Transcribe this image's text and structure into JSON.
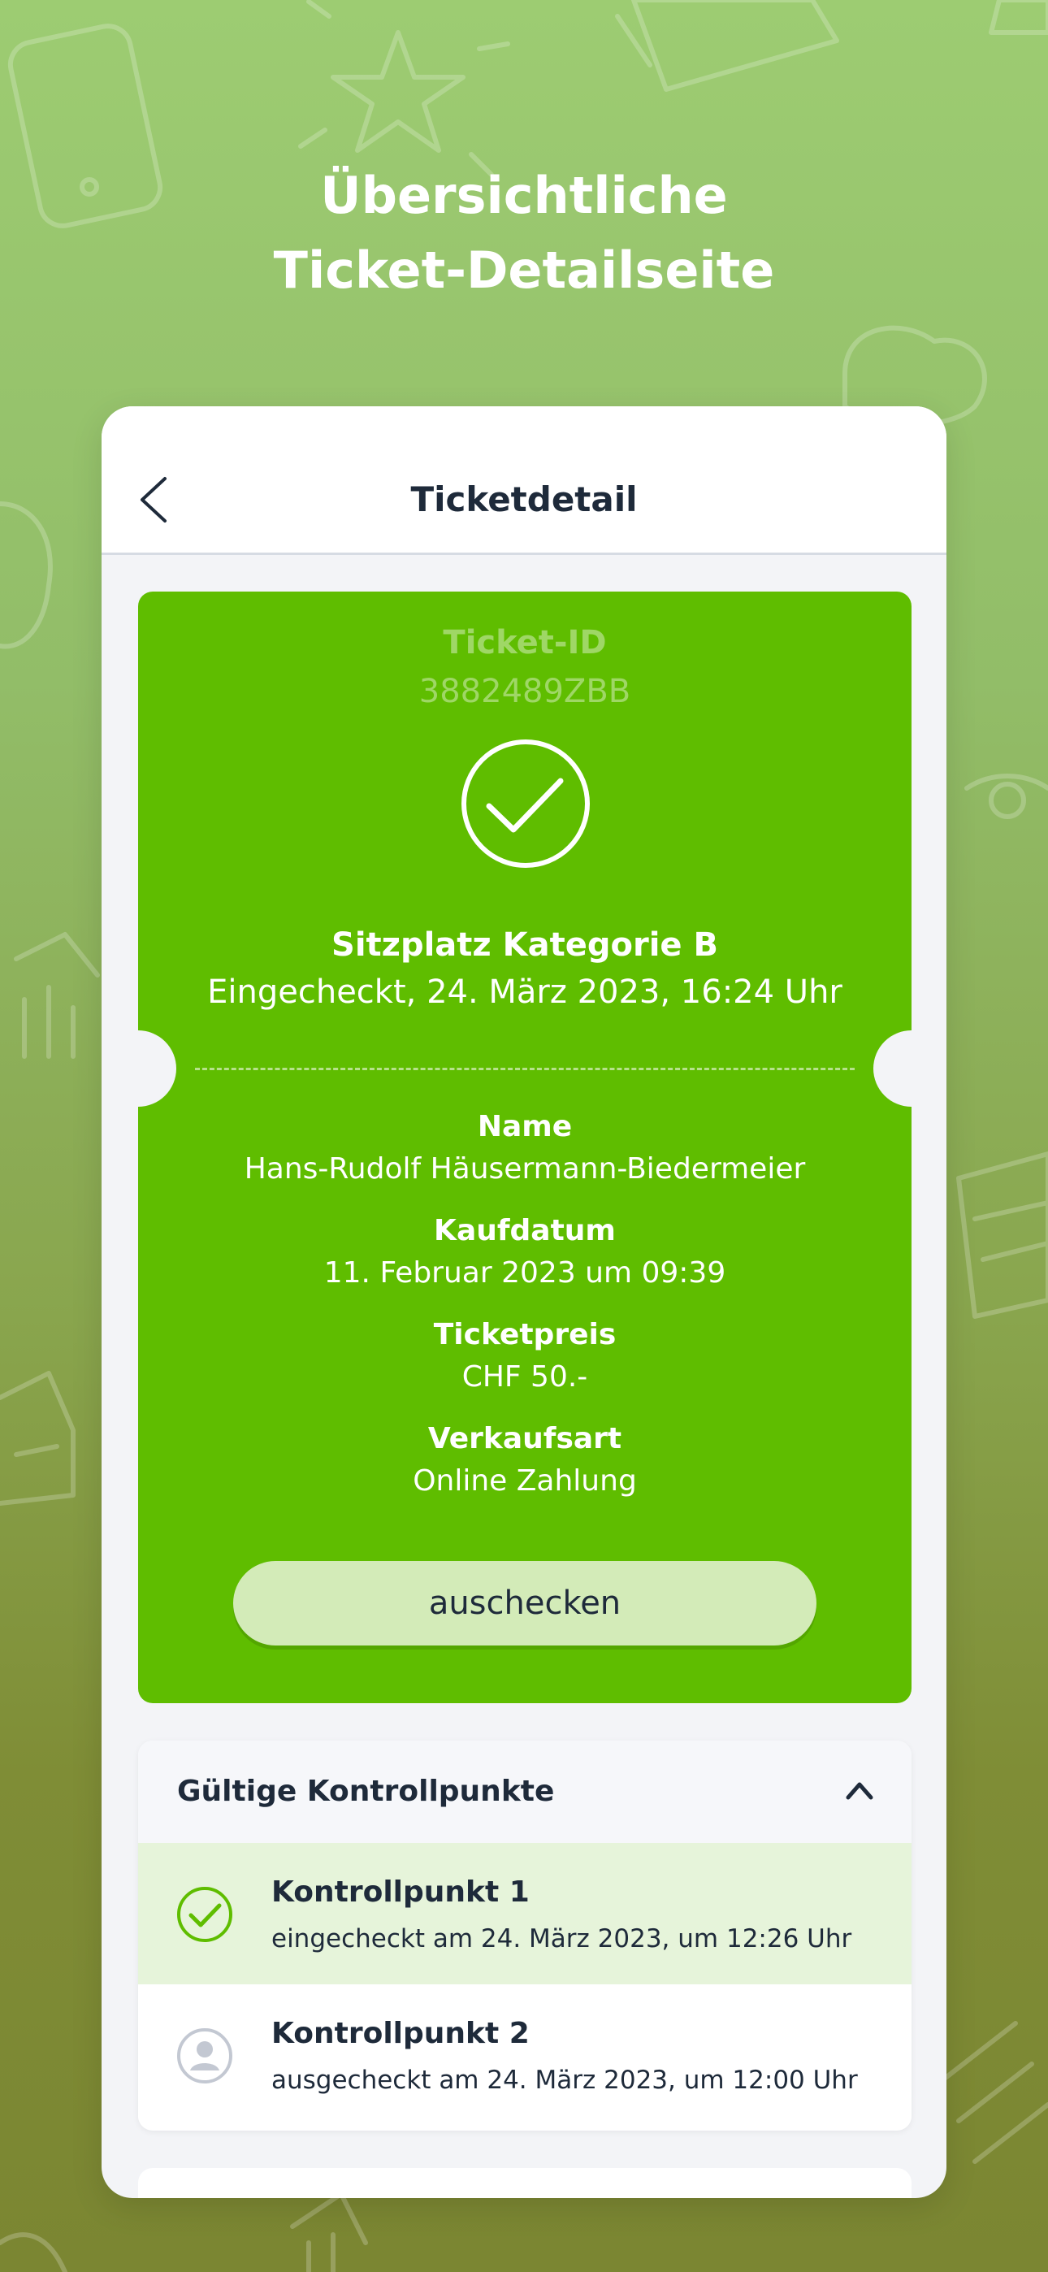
{
  "headline": {
    "line1": "Übersichtliche",
    "line2": "Ticket-Detailseite"
  },
  "navbar": {
    "title": "Ticketdetail",
    "back_icon": "chevron-left-icon"
  },
  "ticket": {
    "id_label": "Ticket-ID",
    "id_value": "3882489ZBB",
    "status_icon": "check-circle-icon",
    "category": "Sitzplatz Kategorie B",
    "checked_in": "Eingecheckt, 24. März 2023, 16:24 Uhr",
    "fields": [
      {
        "label": "Name",
        "value": "Hans-Rudolf Häusermann-Biedermeier"
      },
      {
        "label": "Kaufdatum",
        "value": "11. Februar 2023 um 09:39"
      },
      {
        "label": "Ticketpreis",
        "value": "CHF 50.-"
      },
      {
        "label": "Verkaufsart",
        "value": "Online Zahlung"
      }
    ],
    "button_label": "auschecken",
    "color": "#5fbd00"
  },
  "checkpoints": {
    "title": "Gültige Kontrollpunkte",
    "toggle_icon": "chevron-up-icon",
    "items": [
      {
        "name": "Kontrollpunkt 1",
        "detail": "eingecheckt am 24. März 2023, um 12:26 Uhr",
        "icon": "check-circle-icon",
        "active": true
      },
      {
        "name": "Kontrollpunkt 2",
        "detail": "ausgecheckt am 24. März 2023, um 12:00 Uhr",
        "icon": "user-avatar-icon",
        "active": false
      }
    ]
  },
  "colors": {
    "accent": "#5fbd00",
    "active_row": "#e6f4da",
    "button": "#d3ebb8",
    "text": "#1e2a3a"
  }
}
